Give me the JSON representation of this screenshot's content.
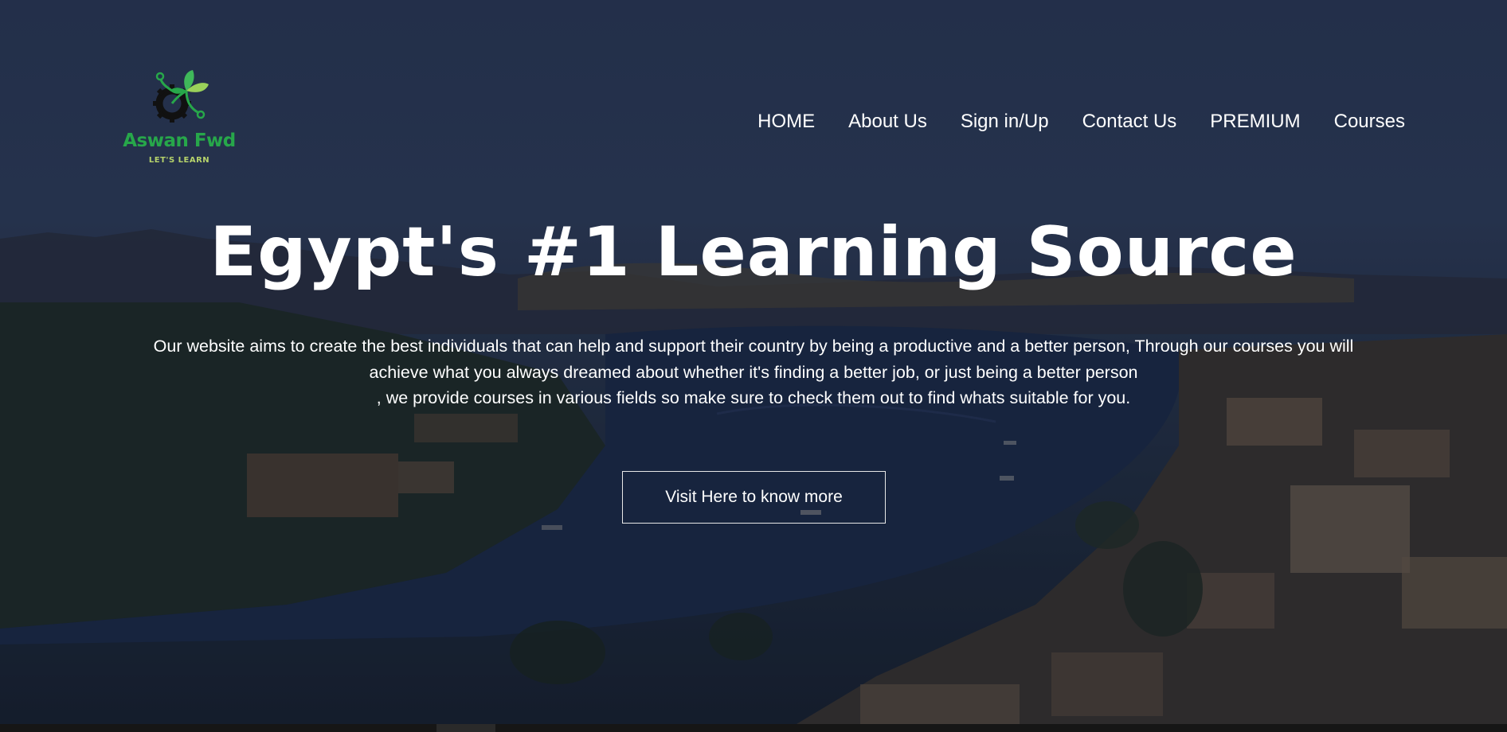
{
  "logo": {
    "name": "Aswan Fwd",
    "tagline": "LET'S LEARN",
    "icon": "gear-sprout-icon"
  },
  "nav": {
    "items": [
      {
        "label": "HOME"
      },
      {
        "label": "About Us"
      },
      {
        "label": "Sign in/Up"
      },
      {
        "label": "Contact Us"
      },
      {
        "label": "PREMIUM"
      },
      {
        "label": "Courses"
      }
    ]
  },
  "hero": {
    "headline": "Egypt's #1 Learning Source",
    "description_lines": [
      "Our website aims to create the best individuals that can help and support their country by being a productive and a better person, Through our courses you will",
      "achieve what you always dreamed about whether it's finding a better job, or just being a better person",
      ", we provide courses in various fields so make sure to check them out to find whats suitable for you."
    ],
    "cta_label": "Visit Here to know more"
  },
  "colors": {
    "brand_green": "#27a74a",
    "tagline_green": "#b6d36b",
    "text": "#ffffff"
  }
}
